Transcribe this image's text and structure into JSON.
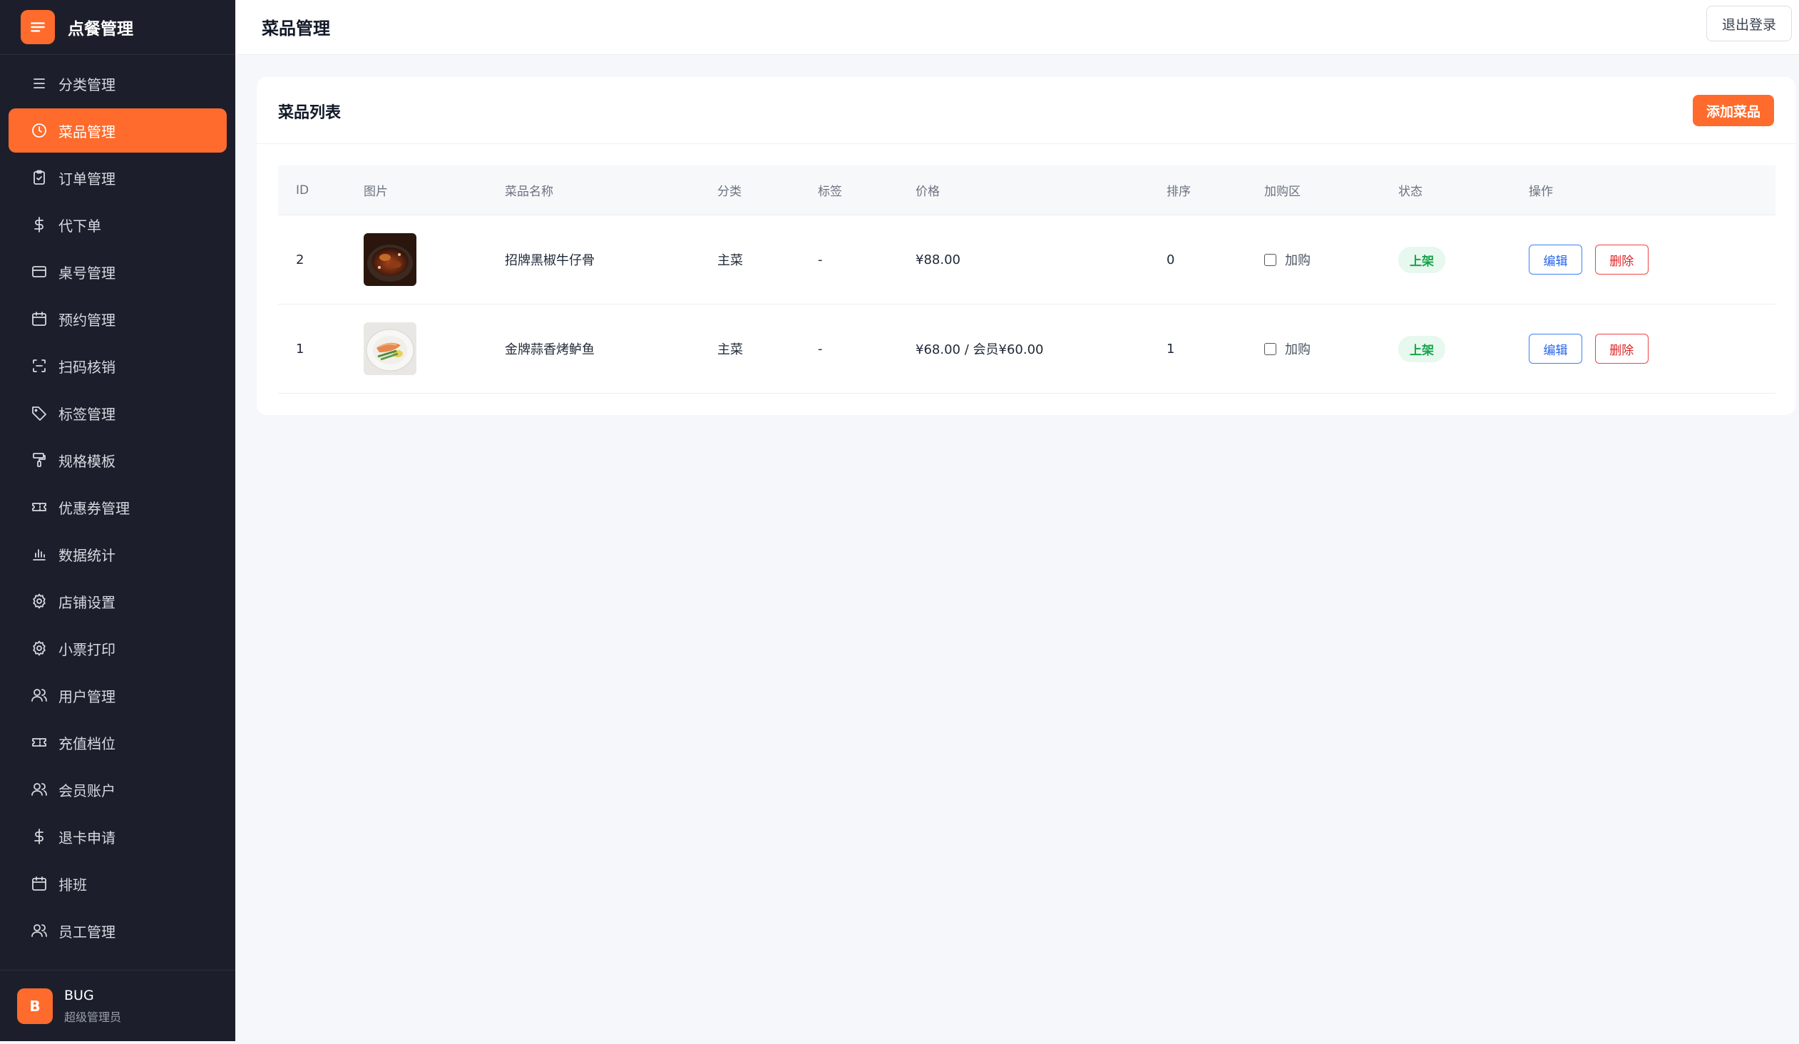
{
  "app": {
    "title": "点餐管理"
  },
  "sidebar": {
    "items": [
      {
        "label": "分类管理",
        "icon": "menu-lines-icon",
        "active": false
      },
      {
        "label": "菜品管理",
        "icon": "clock-icon",
        "active": true
      },
      {
        "label": "订单管理",
        "icon": "clipboard-icon",
        "active": false
      },
      {
        "label": "代下单",
        "icon": "dollar-icon",
        "active": false
      },
      {
        "label": "桌号管理",
        "icon": "card-icon",
        "active": false
      },
      {
        "label": "预约管理",
        "icon": "calendar-icon",
        "active": false
      },
      {
        "label": "扫码核销",
        "icon": "scan-icon",
        "active": false
      },
      {
        "label": "标签管理",
        "icon": "tag-icon",
        "active": false
      },
      {
        "label": "规格模板",
        "icon": "paint-roller-icon",
        "active": false
      },
      {
        "label": "优惠券管理",
        "icon": "ticket-icon",
        "active": false
      },
      {
        "label": "数据统计",
        "icon": "bar-chart-icon",
        "active": false
      },
      {
        "label": "店铺设置",
        "icon": "gear-icon",
        "active": false
      },
      {
        "label": "小票打印",
        "icon": "gear-icon",
        "active": false
      },
      {
        "label": "用户管理",
        "icon": "users-icon",
        "active": false
      },
      {
        "label": "充值档位",
        "icon": "ticket-icon",
        "active": false
      },
      {
        "label": "会员账户",
        "icon": "users-icon",
        "active": false
      },
      {
        "label": "退卡申请",
        "icon": "dollar-icon",
        "active": false
      },
      {
        "label": "排班",
        "icon": "calendar-icon",
        "active": false
      },
      {
        "label": "员工管理",
        "icon": "users-icon",
        "active": false
      }
    ]
  },
  "user": {
    "avatar": "B",
    "name": "BUG",
    "role": "超级管理员"
  },
  "header": {
    "title": "菜品管理",
    "logout_label": "退出登录"
  },
  "card": {
    "title": "菜品列表",
    "add_label": "添加菜品"
  },
  "table": {
    "columns": [
      "ID",
      "图片",
      "菜品名称",
      "分类",
      "标签",
      "价格",
      "排序",
      "加购区",
      "状态",
      "操作"
    ],
    "rows": [
      {
        "id": "2",
        "image": "braised-beef-ribs-photo",
        "name": "招牌黑椒牛仔骨",
        "category": "主菜",
        "tag": "-",
        "price": "¥88.00",
        "sort": "0",
        "addon": "加购",
        "status": "上架",
        "edit": "编辑",
        "delete": "删除"
      },
      {
        "id": "1",
        "image": "grilled-fish-plate-photo",
        "name": "金牌蒜香烤鲈鱼",
        "category": "主菜",
        "tag": "-",
        "price": "¥68.00 / 会员¥60.00",
        "sort": "1",
        "addon": "加购",
        "status": "上架",
        "edit": "编辑",
        "delete": "删除"
      }
    ]
  },
  "colors": {
    "accent": "#ff6b2c",
    "sidebar_bg": "#1c1f2b",
    "status_green": "#16a34a"
  }
}
